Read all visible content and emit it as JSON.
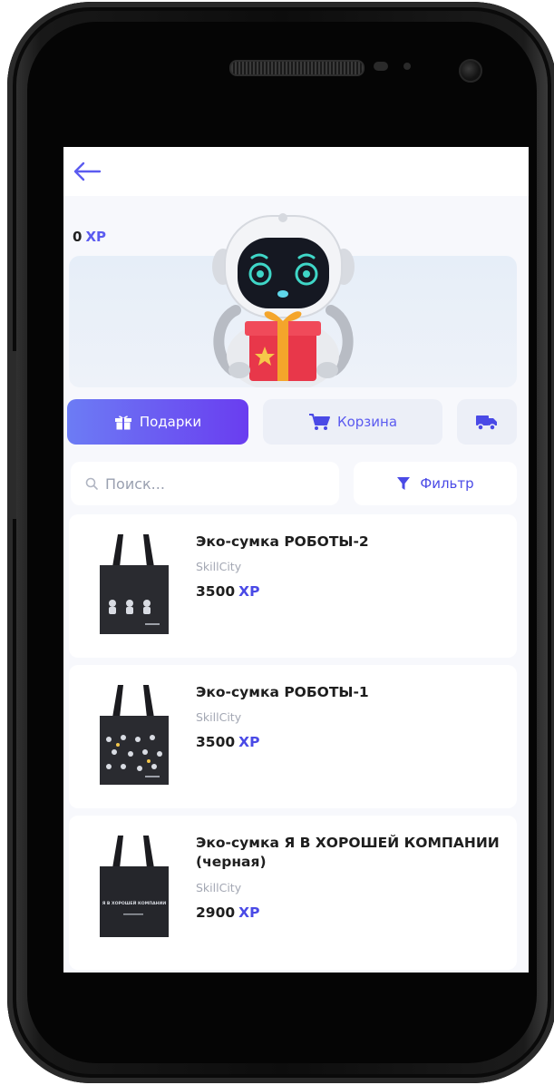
{
  "header": {
    "back_icon": "arrow-left-icon"
  },
  "balance": {
    "amount": "0",
    "unit": "XP"
  },
  "banner": {
    "image": "robot-with-gift"
  },
  "tabs": [
    {
      "label": "Подарки",
      "icon": "gift-icon",
      "active": true
    },
    {
      "label": "Корзина",
      "icon": "cart-icon",
      "active": false
    },
    {
      "label": "",
      "icon": "truck-icon",
      "active": false
    }
  ],
  "search": {
    "placeholder": "Поиск...",
    "icon": "search-icon"
  },
  "filter": {
    "label": "Фильтр",
    "icon": "filter-icon"
  },
  "products": [
    {
      "name": "Эко-сумка РОБОТЫ-2",
      "brand": "SkillCity",
      "price": "3500",
      "currency": "XP"
    },
    {
      "name": "Эко-сумка РОБОТЫ-1",
      "brand": "SkillCity",
      "price": "3500",
      "currency": "XP"
    },
    {
      "name": "Эко-сумка Я В ХОРОШЕЙ КОМПАНИИ (черная)",
      "brand": "SkillCity",
      "price": "2900",
      "currency": "XP",
      "bag_print": "Я В ХОРОШЕЙ КОМПАНИИ"
    }
  ],
  "colors": {
    "accent": "#4a4ae6",
    "tab_active_start": "#6c7cf4",
    "tab_active_end": "#6a3df0",
    "background": "#f7f8fc"
  }
}
